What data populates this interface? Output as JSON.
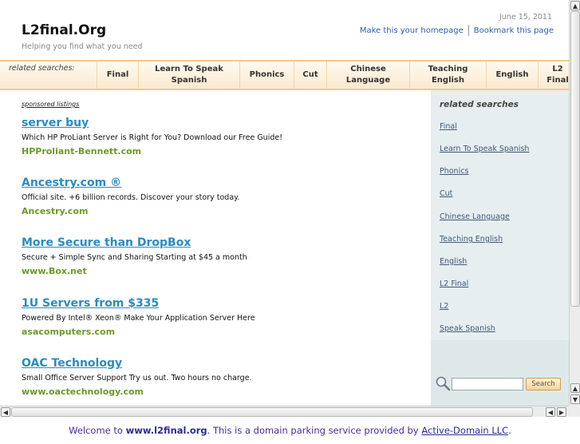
{
  "header": {
    "title": "L2final.Org",
    "tagline": "Helping you find what you need",
    "date": "June 15, 2011",
    "homepage_link": "Make this your homepage",
    "bookmark_link": "Bookmark this page"
  },
  "topnav": {
    "label": "related searches:",
    "items": [
      {
        "line1": "Final",
        "line2": ""
      },
      {
        "line1": "Learn To Speak",
        "line2": "Spanish"
      },
      {
        "line1": "Phonics",
        "line2": ""
      },
      {
        "line1": "Cut",
        "line2": ""
      },
      {
        "line1": "Chinese",
        "line2": "Language"
      },
      {
        "line1": "Teaching",
        "line2": "English"
      },
      {
        "line1": "English",
        "line2": ""
      },
      {
        "line1": "L2",
        "line2": "Final"
      }
    ]
  },
  "sponsored": {
    "label": "sponsored listings",
    "listings": [
      {
        "title": "server buy",
        "desc": "Which HP ProLiant Server is Right for You? Download our Free Guide!",
        "url": "HPProliant-Bennett.com"
      },
      {
        "title": "Ancestry.com ®",
        "desc": "Official site. +6 billion records. Discover your story today.",
        "url": "Ancestry.com"
      },
      {
        "title": "More Secure than DropBox",
        "desc": "Secure + Simple Sync and Sharing Starting at $45 a month",
        "url": "www.Box.net"
      },
      {
        "title": "1U Servers from $335",
        "desc": "Powered By Intel® Xeon® Make Your Application Server Here",
        "url": "asacomputers.com"
      },
      {
        "title": "OAC Technology",
        "desc": "Small Office Server Support Try us out. Two hours no charge.",
        "url": "www.oactechnology.com"
      }
    ]
  },
  "sidebar": {
    "heading": "related searches",
    "items": [
      "Final",
      "Learn To Speak Spanish",
      "Phonics",
      "Cut",
      "Chinese Language",
      "Teaching English",
      "English",
      "L2 Final",
      "L2",
      "Speak Spanish"
    ],
    "search_placeholder": "",
    "search_button": "Search"
  },
  "footer": {
    "prefix": "Welcome to ",
    "domain": "www.l2final.org",
    "middle": ". This is a domain parking service provided by ",
    "provider": "Active-Domain LLC",
    "suffix": "."
  },
  "scrollbars": {
    "up": "▲",
    "down": "▼",
    "left": "◀",
    "right": "▶"
  }
}
